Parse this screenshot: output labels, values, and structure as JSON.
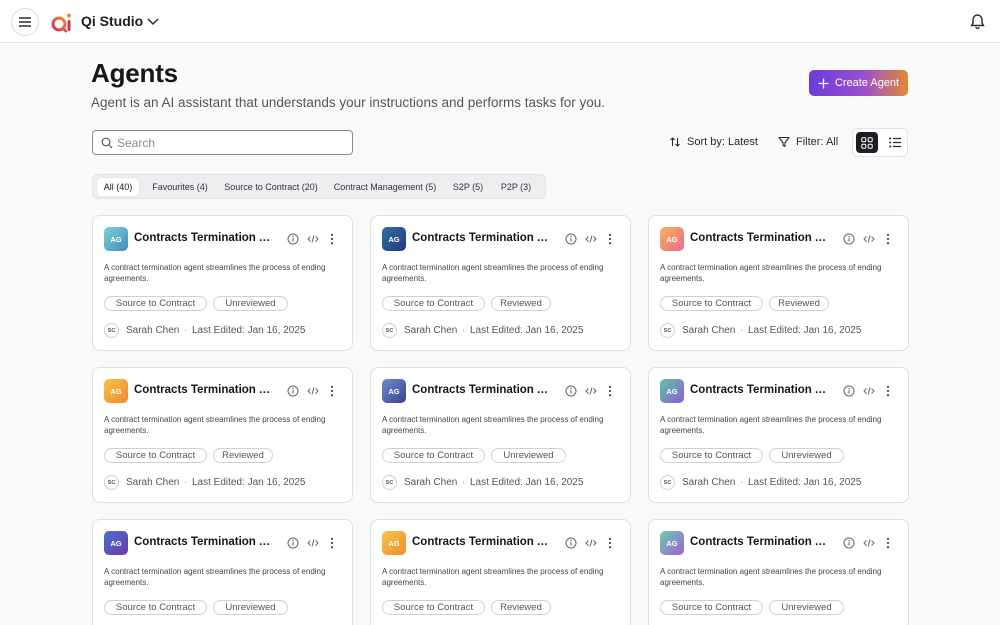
{
  "app": {
    "name": "Qi Studio",
    "logo_text": "Qi"
  },
  "header": {
    "title": "Agents",
    "subtitle": "Agent is an AI assistant that understands your instructions and performs tasks for you.",
    "create_label": "Create Agent"
  },
  "search": {
    "placeholder": "Search",
    "value": ""
  },
  "toolbar": {
    "sort_label": "Sort by: Latest",
    "filter_label": "Filter: All"
  },
  "tabs": [
    {
      "label": "All (40)",
      "active": true
    },
    {
      "label": "Favourites (4)"
    },
    {
      "label": "Source to Contract (20)"
    },
    {
      "label": "Contract Management (5)"
    },
    {
      "label": "S2P (5)"
    },
    {
      "label": "P2P (3)"
    }
  ],
  "colors": {
    "accent_gradient": [
      "#6a3ddb",
      "#e08a32"
    ],
    "avatar_teal": "#5fb7c9",
    "avatar_navy": "#36508f",
    "avatar_orange": "#f2a24a",
    "avatar_pink": "#e8718a"
  },
  "cards": [
    {
      "initials": "AG",
      "title": "Contracts Termination Agent",
      "description": "A contract termination agent streamlines the process of ending agreements.",
      "category": "Source to Contract",
      "status": "Unreviewed",
      "author_initials": "SC",
      "author": "Sarah Chen",
      "edited": "Last Edited: Jan 16, 2025"
    },
    {
      "initials": "AG",
      "title": "Contracts Termination Agent",
      "description": "A contract termination agent streamlines the process of ending agreements.",
      "category": "Source to Contract",
      "status": "Reviewed",
      "author_initials": "SC",
      "author": "Sarah Chen",
      "edited": "Last Edited: Jan 16, 2025"
    },
    {
      "initials": "AG",
      "title": "Contracts Termination Agent",
      "description": "A contract termination agent streamlines the process of ending agreements.",
      "category": "Source to Contract",
      "status": "Reviewed",
      "author_initials": "SC",
      "author": "Sarah Chen",
      "edited": "Last Edited: Jan 16, 2025"
    },
    {
      "initials": "AG",
      "title": "Contracts Termination Agent",
      "description": "A contract termination agent streamlines the process of ending agreements.",
      "category": "Source to Contract",
      "status": "Reviewed",
      "author_initials": "SC",
      "author": "Sarah Chen",
      "edited": "Last Edited: Jan 16, 2025"
    },
    {
      "initials": "AG",
      "title": "Contracts Termination Agent",
      "description": "A contract termination agent streamlines the process of ending agreements.",
      "category": "Source to Contract",
      "status": "Unreviewed",
      "author_initials": "SC",
      "author": "Sarah Chen",
      "edited": "Last Edited: Jan 16, 2025"
    },
    {
      "initials": "AG",
      "title": "Contracts Termination Agent",
      "description": "A contract termination agent streamlines the process of ending agreements.",
      "category": "Source to Contract",
      "status": "Unreviewed",
      "author_initials": "SC",
      "author": "Sarah Chen",
      "edited": "Last Edited: Jan 16, 2025"
    },
    {
      "initials": "AG",
      "title": "Contracts Termination Agent",
      "description": "A contract termination agent streamlines the process of ending agreements.",
      "category": "Source to Contract",
      "status": "Unreviewed"
    },
    {
      "initials": "AG",
      "title": "Contracts Termination Agent",
      "description": "A contract termination agent streamlines the process of ending agreements.",
      "category": "Source to Contract",
      "status": "Reviewed"
    },
    {
      "initials": "AG",
      "title": "Contracts Termination Agent",
      "description": "A contract termination agent streamlines the process of ending agreements.",
      "category": "Source to Contract",
      "status": "Unreviewed"
    }
  ]
}
